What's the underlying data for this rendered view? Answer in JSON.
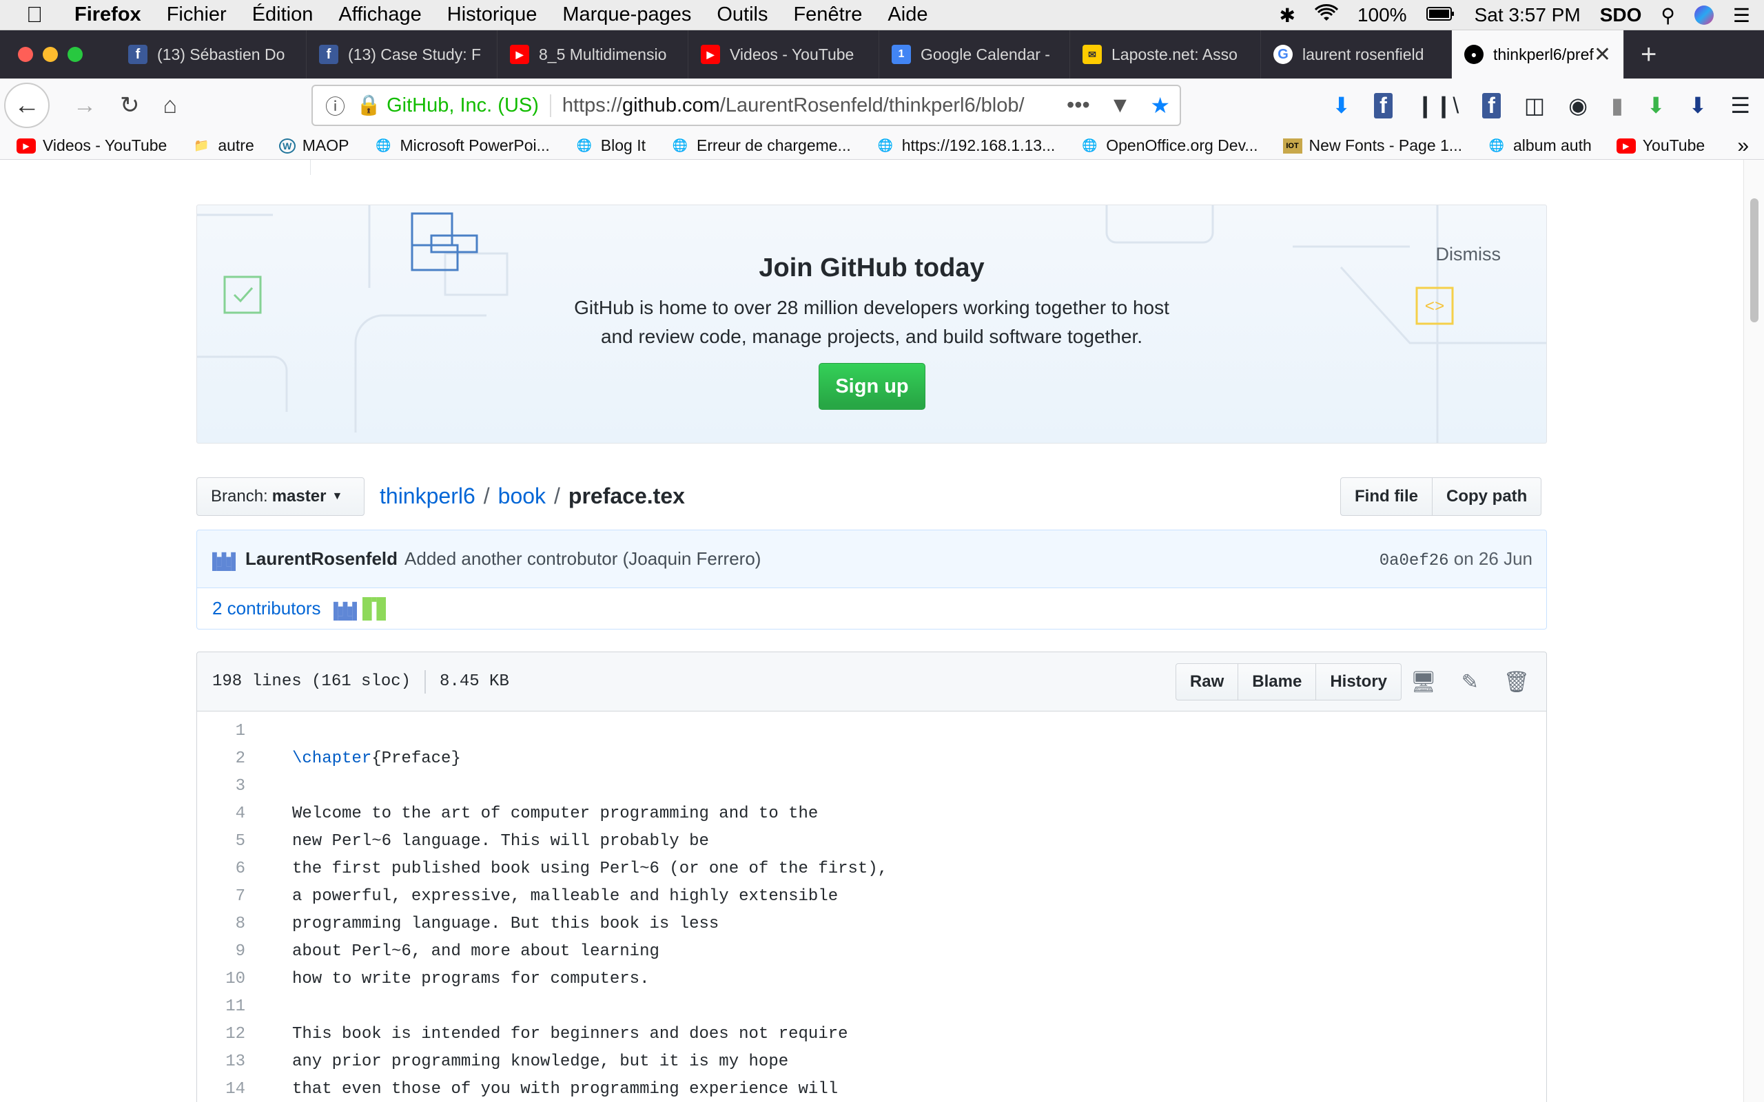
{
  "menubar": {
    "app": "Firefox",
    "items": [
      "Fichier",
      "Édition",
      "Affichage",
      "Historique",
      "Marque-pages",
      "Outils",
      "Fenêtre",
      "Aide"
    ],
    "battery": "100%",
    "clock": "Sat 3:57 PM",
    "user": "SDO"
  },
  "tabs": [
    {
      "label": "(13) Sébastien Do",
      "icon": "facebook-icon",
      "color": "#3b5998"
    },
    {
      "label": "(13) Case Study: F",
      "icon": "facebook-icon",
      "color": "#3b5998"
    },
    {
      "label": "8_5 Multidimensio",
      "icon": "youtube-icon",
      "color": "#ff0000"
    },
    {
      "label": "Videos - YouTube",
      "icon": "youtube-icon",
      "color": "#ff0000"
    },
    {
      "label": "Google Calendar -",
      "icon": "calendar-icon",
      "color": "#4285f4"
    },
    {
      "label": "Laposte.net: Asso",
      "icon": "laposte-icon",
      "color": "#ffcc00"
    },
    {
      "label": "laurent rosenfield",
      "icon": "google-icon",
      "color": "#ffffff"
    },
    {
      "label": "thinkperl6/pref",
      "icon": "github-icon",
      "color": "#000000",
      "active": true
    }
  ],
  "toolbar": {
    "org": "GitHub, Inc. (US)",
    "url_prefix": "https://",
    "url_host": "github.com",
    "url_path": "/LaurentRosenfeld/thinkperl6/blob/"
  },
  "bookmarks": [
    {
      "label": "Videos - YouTube",
      "icon": "youtube-icon"
    },
    {
      "label": "autre",
      "icon": "folder-icon"
    },
    {
      "label": "MAOP",
      "icon": "wordpress-icon"
    },
    {
      "label": "Microsoft PowerPoi...",
      "icon": "globe-icon"
    },
    {
      "label": "Blog It",
      "icon": "globe-icon"
    },
    {
      "label": "Erreur de chargeme...",
      "icon": "globe-icon"
    },
    {
      "label": "https://192.168.1.13...",
      "icon": "globe-icon"
    },
    {
      "label": "OpenOffice.org Dev...",
      "icon": "globe-icon"
    },
    {
      "label": "New Fonts - Page 1...",
      "icon": "fonts-icon"
    },
    {
      "label": "album auth",
      "icon": "globe-icon"
    },
    {
      "label": "YouTube",
      "icon": "youtube-icon"
    }
  ],
  "banner": {
    "title": "Join GitHub today",
    "line1": "GitHub is home to over 28 million developers working together to host",
    "line2": "and review code, manage projects, and build software together.",
    "signup": "Sign up",
    "dismiss": "Dismiss"
  },
  "repo": {
    "branch_label": "Branch:",
    "branch": "master",
    "owner": "thinkperl6",
    "dir": "book",
    "file": "preface.tex",
    "find_file": "Find file",
    "copy_path": "Copy path"
  },
  "commit": {
    "author": "LaurentRosenfeld",
    "message": "Added another controbutor (Joaquin Ferrero)",
    "sha": "0a0ef26",
    "date": "on 26 Jun",
    "contributors": "2 contributors"
  },
  "file": {
    "lines": "198 lines (161 sloc)",
    "size": "8.45 KB",
    "raw": "Raw",
    "blame": "Blame",
    "history": "History"
  },
  "code_lines": [
    {
      "n": "1",
      "t": ""
    },
    {
      "n": "2",
      "t": "{Preface}",
      "kw": "\\chapter"
    },
    {
      "n": "3",
      "t": ""
    },
    {
      "n": "4",
      "t": "Welcome to the art of computer programming and to the"
    },
    {
      "n": "5",
      "t": "new Perl~6 language. This will probably be"
    },
    {
      "n": "6",
      "t": "the first published book using Perl~6 (or one of the first),"
    },
    {
      "n": "7",
      "t": "a powerful, expressive, malleable and highly extensible"
    },
    {
      "n": "8",
      "t": "programming language. But this book is less"
    },
    {
      "n": "9",
      "t": "about Perl~6, and more about learning"
    },
    {
      "n": "10",
      "t": "how to write programs for computers."
    },
    {
      "n": "11",
      "t": ""
    },
    {
      "n": "12",
      "t": "This book is intended for beginners and does not require"
    },
    {
      "n": "13",
      "t": "any prior programming knowledge, but it is my hope"
    },
    {
      "n": "14",
      "t": "that even those of you with programming experience will"
    }
  ]
}
